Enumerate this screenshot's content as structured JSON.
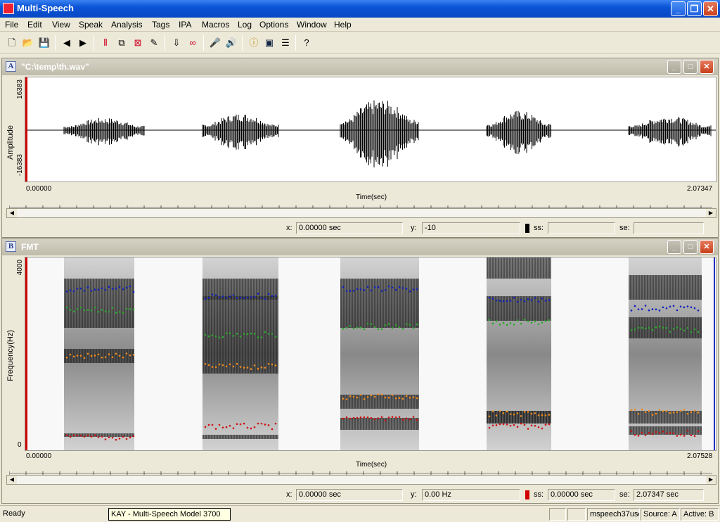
{
  "app": {
    "title": "Multi-Speech",
    "window_controls": [
      "minimize-icon",
      "restore-icon",
      "close-icon"
    ]
  },
  "menu": [
    "File",
    "Edit",
    "View",
    "Speak",
    "Analysis",
    "Tags",
    "IPA",
    "Macros",
    "Log",
    "Options",
    "Window",
    "Help"
  ],
  "toolbar": {
    "icons": [
      "new-icon",
      "open-icon",
      "save-icon",
      "back-arrow-icon",
      "forward-arrow-icon",
      "spectrum-icon",
      "copy-window-icon",
      "close-window-icon",
      "eraser-icon",
      "download-icon",
      "link-icon",
      "microphone-icon",
      "speaker-icon",
      "info-icon",
      "display-icon",
      "list-icon",
      "help-icon"
    ]
  },
  "window_a": {
    "letter": "A",
    "title": "\"C:\\temp\\th.wav\"",
    "y_axis_label": "Amplitude",
    "y_max": "16383",
    "y_min": "-16383",
    "x_start": "0.00000",
    "x_end": "2.07347",
    "x_axis_label": "Time(sec)",
    "status": {
      "x_label": "x:",
      "x_value": "0.00000 sec",
      "y_label": "y:",
      "y_value": "-10",
      "ss_label": "ss:",
      "ss_value": "",
      "se_label": "se:",
      "se_value": ""
    }
  },
  "window_b": {
    "letter": "B",
    "title": "FMT",
    "y_axis_label": "Frequency(Hz)",
    "y_max": "4000",
    "y_min": "0",
    "x_start": "0.00000",
    "x_end": "2.07528",
    "x_axis_label": "Time(sec)",
    "status": {
      "x_label": "x:",
      "x_value": "0.00000 sec",
      "y_label": "y:",
      "y_value": "0.00 Hz",
      "ss_label": "ss:",
      "ss_value": "0.00000 sec",
      "se_label": "se:",
      "se_value": "2.07347 sec"
    }
  },
  "statusbar": {
    "ready": "Ready",
    "model": "KAY - Multi-Speech Model 3700",
    "file": "mspeech37use",
    "source": "Source: A",
    "active": "Active: B"
  },
  "colors": {
    "f1": "#d01010",
    "f2": "#f08a1c",
    "f3": "#2aa82a",
    "f4": "#1020c0",
    "cursor": "#d00000"
  }
}
